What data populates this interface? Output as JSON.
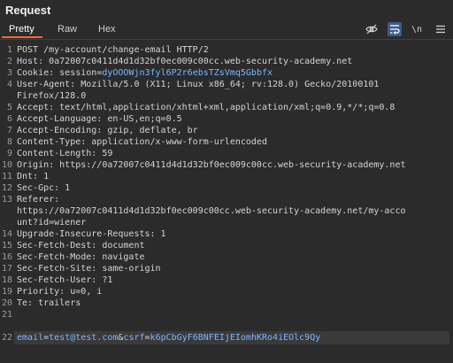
{
  "panel": {
    "title": "Request"
  },
  "tabs": [
    {
      "label": "Pretty",
      "active": true
    },
    {
      "label": "Raw",
      "active": false
    },
    {
      "label": "Hex",
      "active": false
    }
  ],
  "toolbar": {
    "icons": [
      "eye-off-icon",
      "wrap-lines-icon",
      "newline-icon",
      "menu-icon"
    ],
    "newline_label": "\\n"
  },
  "editor": {
    "line_numbers": [
      "1",
      "2",
      "3",
      "4",
      "",
      "5",
      "6",
      "7",
      "8",
      "9",
      "10",
      "11",
      "12",
      "13",
      "",
      "",
      "14",
      "15",
      "16",
      "17",
      "18",
      "19",
      "20",
      "21",
      "",
      "22"
    ],
    "lines": [
      {
        "segments": [
          {
            "t": "POST /my-account/change-email HTTP/2",
            "c": ""
          }
        ]
      },
      {
        "segments": [
          {
            "t": "Host: 0a72007c0411d4d1d32bf0ec009c00cc.web-security-academy.net",
            "c": ""
          }
        ]
      },
      {
        "segments": [
          {
            "t": "Cookie: session",
            "c": ""
          },
          {
            "t": "=",
            "c": ""
          },
          {
            "t": "dyOOOWjn3fyl6P2r6ebsTZsVmq5Gbbfx",
            "c": "blue"
          }
        ]
      },
      {
        "segments": [
          {
            "t": "User-Agent: Mozilla/5.0 (X11; Linux x86_64; rv:128.0) Gecko/20100101",
            "c": ""
          }
        ]
      },
      {
        "segments": [
          {
            "t": "Firefox/128.0",
            "c": ""
          }
        ]
      },
      {
        "segments": [
          {
            "t": "Accept: text/html,application/xhtml+xml,application/xml;q=0.9,*/*;q=0.8",
            "c": ""
          }
        ]
      },
      {
        "segments": [
          {
            "t": "Accept-Language: en-US,en;q=0.5",
            "c": ""
          }
        ]
      },
      {
        "segments": [
          {
            "t": "Accept-Encoding: gzip, deflate, br",
            "c": ""
          }
        ]
      },
      {
        "segments": [
          {
            "t": "Content-Type: application/x-www-form-urlencoded",
            "c": ""
          }
        ]
      },
      {
        "segments": [
          {
            "t": "Content-Length: 59",
            "c": ""
          }
        ]
      },
      {
        "segments": [
          {
            "t": "Origin: https://0a72007c0411d4d1d32bf0ec009c00cc.web-security-academy.net",
            "c": ""
          }
        ]
      },
      {
        "segments": [
          {
            "t": "Dnt: 1",
            "c": ""
          }
        ]
      },
      {
        "segments": [
          {
            "t": "Sec-Gpc: 1",
            "c": ""
          }
        ]
      },
      {
        "segments": [
          {
            "t": "Referer:",
            "c": ""
          }
        ]
      },
      {
        "segments": [
          {
            "t": "https://0a72007c0411d4d1d32bf0ec009c00cc.web-security-academy.net/my-acco",
            "c": ""
          }
        ]
      },
      {
        "segments": [
          {
            "t": "unt?id=wiener",
            "c": ""
          }
        ]
      },
      {
        "segments": [
          {
            "t": "Upgrade-Insecure-Requests: 1",
            "c": ""
          }
        ]
      },
      {
        "segments": [
          {
            "t": "Sec-Fetch-Dest: document",
            "c": ""
          }
        ]
      },
      {
        "segments": [
          {
            "t": "Sec-Fetch-Mode: navigate",
            "c": ""
          }
        ]
      },
      {
        "segments": [
          {
            "t": "Sec-Fetch-Site: same-origin",
            "c": ""
          }
        ]
      },
      {
        "segments": [
          {
            "t": "Sec-Fetch-User: ?1",
            "c": ""
          }
        ]
      },
      {
        "segments": [
          {
            "t": "Priority: u=0, i",
            "c": ""
          }
        ]
      },
      {
        "segments": [
          {
            "t": "Te: trailers",
            "c": ""
          }
        ]
      },
      {
        "segments": [
          {
            "t": "",
            "c": ""
          }
        ]
      },
      {
        "segments": [
          {
            "t": "",
            "c": ""
          }
        ]
      },
      {
        "segments": [
          {
            "t": "email",
            "c": "blue"
          },
          {
            "t": "=",
            "c": ""
          },
          {
            "t": "test@test.com",
            "c": "blue"
          },
          {
            "t": "&",
            "c": ""
          },
          {
            "t": "csrf",
            "c": "blue"
          },
          {
            "t": "=",
            "c": ""
          },
          {
            "t": "k6pCbGyF6BNFEIjEIomhKRo4iEOlc9Qy",
            "c": "blue"
          }
        ]
      }
    ],
    "highlighted_line_index": 25
  },
  "colors": {
    "background": "#2b2b2b",
    "text": "#d4d4d4",
    "param": "#7fb4ff",
    "tab_accent": "#ff6633",
    "active_icon_bg": "#3d5c8a"
  }
}
